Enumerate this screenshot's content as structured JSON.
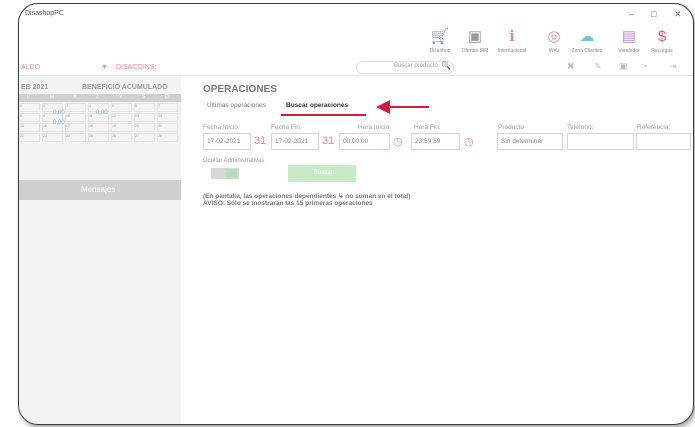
{
  "window": {
    "title": "DisashopPC",
    "controls": {
      "minimize": "–",
      "maximize": "□",
      "close": "✕"
    }
  },
  "toolbar": {
    "items": [
      {
        "label": "Disashop",
        "icon": "cart-icon",
        "glyph": "🛒"
      },
      {
        "label": "Ofertas SIM",
        "icon": "sim-icon",
        "glyph": "▣"
      },
      {
        "label": "Internacional",
        "icon": "international-icon",
        "glyph": "ℹ"
      },
      {
        "label": "Web",
        "icon": "web-icon",
        "glyph": "◎"
      },
      {
        "label": "Zona Clientes",
        "icon": "cloud-icon",
        "glyph": "☁"
      },
      {
        "label": "Vendedor",
        "icon": "vendor-icon",
        "glyph": "▤"
      },
      {
        "label": "Recargas",
        "icon": "dollar-icon",
        "glyph": "$"
      }
    ]
  },
  "balance_bar": {
    "saldo_label": "ALDO",
    "dropdown_glyph": "▼",
    "disacoins_label": "DISACOINS:",
    "search_placeholder": "Buscar producto",
    "search_glyph": "🔍",
    "actions": [
      "✖",
      "✎",
      "▣",
      "◔",
      "⇥"
    ]
  },
  "sidebar": {
    "month_label": "EB 2021",
    "benefit_label": "BENEFICIO ACUMULADO",
    "weekdays": [
      "L",
      "M",
      "X",
      "J",
      "V",
      "S",
      "D"
    ],
    "weeks": [
      [
        "1",
        "2",
        "3",
        "4",
        "5",
        "6",
        "7"
      ],
      [
        "8",
        "9",
        "10",
        "11",
        "12",
        "13",
        "14"
      ],
      [
        "15",
        "16",
        "17",
        "18",
        "19",
        "20",
        "21"
      ],
      [
        "22",
        "23",
        "24",
        "25",
        "26",
        "27",
        "28"
      ]
    ],
    "values": [
      "0,00",
      "0,00",
      "0,00"
    ],
    "messages_label": "Mensajes"
  },
  "main": {
    "title": "OPERACIONES",
    "tabs": [
      {
        "label": "Ultimas operaciones",
        "active": false
      },
      {
        "label": "Buscar operaciones",
        "active": true
      }
    ],
    "filters": {
      "fecha_inicio_label": "Fecha Inicio:",
      "fecha_inicio": "17-02-2021",
      "fecha_fin_label": "Fecha Fin:",
      "fecha_fin": "17-02-2021",
      "hora_inicio_label": "Hora Inicio:",
      "hora_inicio": "00:00:00",
      "hora_fin_label": "Hora Fin:",
      "hora_fin": "23:59:59",
      "producto_label": "Producto",
      "producto": "Sin determinar",
      "telefono_label": "Teléfono:",
      "referencia_label": "Referencia:",
      "calendar_glyph": "31",
      "clock_glyph": "◷"
    },
    "ocultar_label": "Ocultar Administrativas",
    "buscar_label": "Buscar",
    "note_line1": "(En pantalla, las operaciones dependientes ↳ no suman en el total)",
    "note_line2": "AVISO: Sólo se mostrarán las 15 primeras operaciones"
  },
  "colors": {
    "accent": "#c9213f",
    "pink": "#f08c8c",
    "green": "#b8e0b8"
  }
}
